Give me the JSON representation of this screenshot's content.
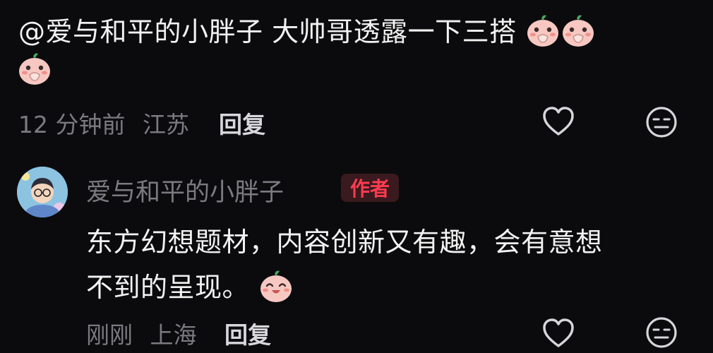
{
  "comment1": {
    "text_line1": "@爱与和平的小胖子 大帅哥透露一下三搭",
    "emoji": "cover-mouth-peach-emoji",
    "time": "12 分钟前",
    "location": "江苏",
    "reply_label": "回复"
  },
  "reply1": {
    "username": "爱与和平的小胖子",
    "badge": "作者",
    "text_line1": "东方幻想题材，内容创新又有趣，会有意想",
    "text_line2": "不到的呈现。",
    "emoji": "happy-peach-emoji",
    "time": "刚刚",
    "location": "上海",
    "reply_label": "回复"
  },
  "icons": {
    "like": "heart-outline-icon",
    "dislike": "meh-face-icon"
  },
  "colors": {
    "background": "#0b0b0d",
    "text": "#f2f2f2",
    "meta": "#7a7a80",
    "badge_bg": "#3a1a1e",
    "badge_text": "#ff3b4f"
  }
}
